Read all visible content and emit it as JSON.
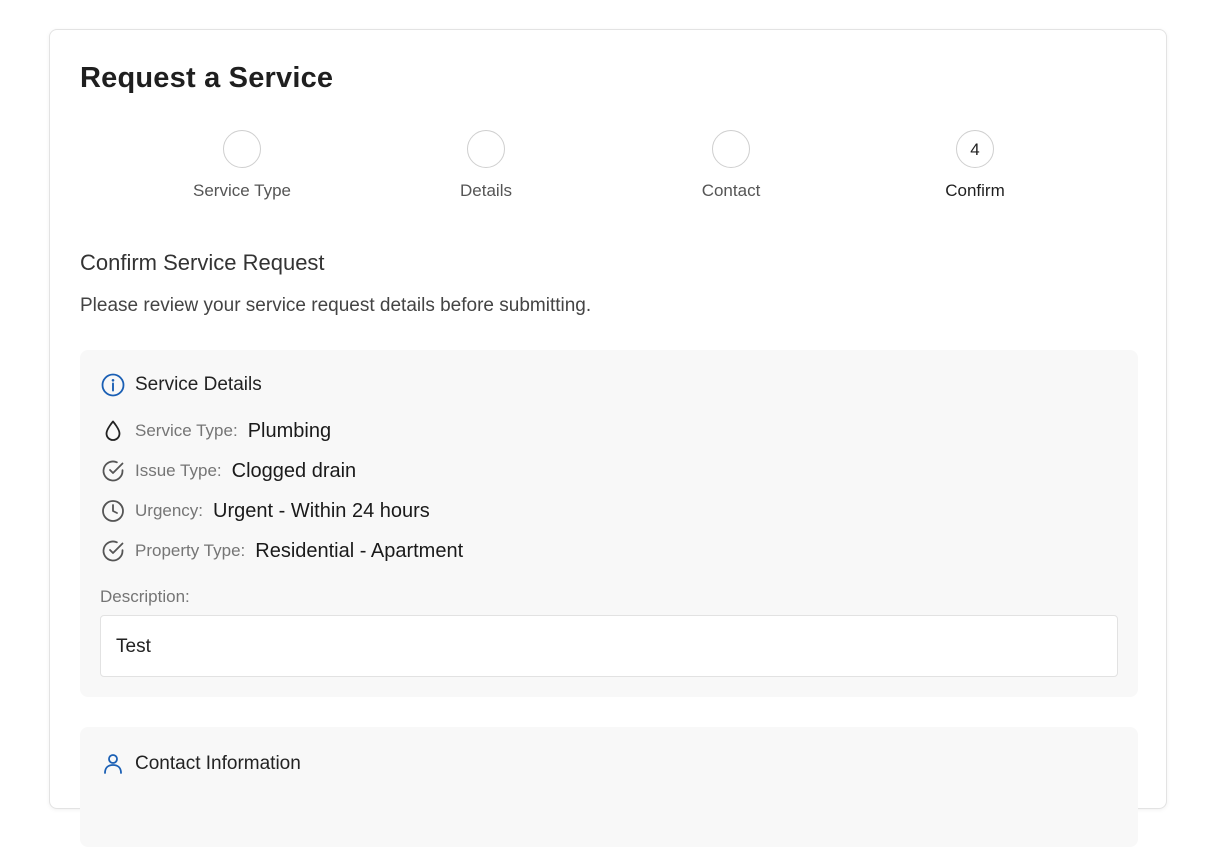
{
  "page": {
    "title": "Request a Service"
  },
  "stepper": {
    "steps": [
      {
        "label": "Service Type",
        "number": ""
      },
      {
        "label": "Details",
        "number": ""
      },
      {
        "label": "Contact",
        "number": ""
      },
      {
        "label": "Confirm",
        "number": "4"
      }
    ],
    "active_step": 4
  },
  "confirm": {
    "title": "Confirm Service Request",
    "description": "Please review your service request details before submitting."
  },
  "service_details": {
    "heading": "Service Details",
    "heading_icon": "info-icon",
    "rows": [
      {
        "icon": "droplet-icon",
        "label": "Service Type:",
        "value": "Plumbing"
      },
      {
        "icon": "check-circle-icon",
        "label": "Issue Type:",
        "value": "Clogged drain"
      },
      {
        "icon": "clock-icon",
        "label": "Urgency:",
        "value": "Urgent - Within 24 hours"
      },
      {
        "icon": "check-circle-icon",
        "label": "Property Type:",
        "value": "Residential - Apartment"
      }
    ],
    "description_label": "Description:",
    "description_value": "Test"
  },
  "contact_information": {
    "heading": "Contact Information",
    "heading_icon": "person-icon"
  },
  "colors": {
    "accent": "#1a5fb4",
    "panel_bg": "#f8f8f8",
    "muted_text": "#757575"
  }
}
